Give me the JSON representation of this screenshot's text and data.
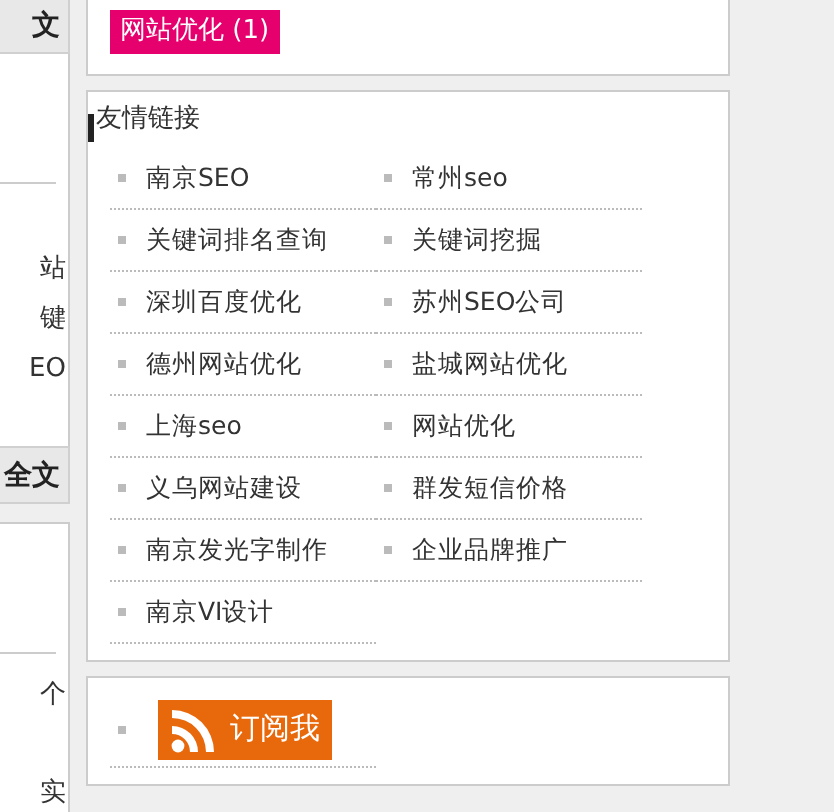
{
  "left_column": {
    "header_top": "文",
    "snippets_a": [
      "站",
      "键",
      "EO"
    ],
    "header_bottom": "全文",
    "snippets_b": [
      "个",
      "实"
    ]
  },
  "tag": {
    "label": "网站优化 (1)"
  },
  "links": {
    "title": "友情链接",
    "items": [
      {
        "label": "南京SEO"
      },
      {
        "label": "常州seo"
      },
      {
        "label": "关键词排名查询"
      },
      {
        "label": "关键词挖掘"
      },
      {
        "label": "深圳百度优化"
      },
      {
        "label": "苏州SEO公司"
      },
      {
        "label": "德州网站优化"
      },
      {
        "label": "盐城网站优化"
      },
      {
        "label": "上海seo"
      },
      {
        "label": "网站优化"
      },
      {
        "label": "义乌网站建设"
      },
      {
        "label": "群发短信价格"
      },
      {
        "label": "南京发光字制作"
      },
      {
        "label": "企业品牌推广"
      },
      {
        "label": "南京VI设计"
      }
    ]
  },
  "subscribe": {
    "label": "订阅我"
  }
}
